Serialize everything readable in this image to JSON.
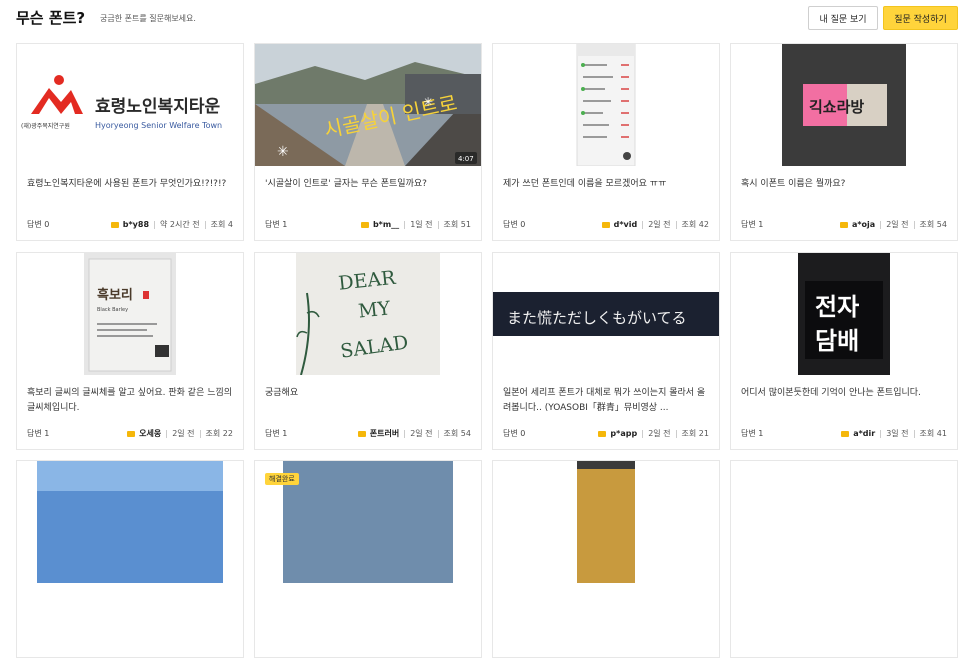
{
  "header": {
    "title": "무슨 폰트?",
    "subtitle": "궁금한 폰트를 질문해보세요.",
    "my_questions_label": "내 질문 보기",
    "write_question_label": "질문 작성하기"
  },
  "cards": [
    {
      "title": "효령노인복지타운에 사용된 폰트가 무엇인가요!?!?!?",
      "answers": "답변 0",
      "author": "b*y88",
      "time": "약 2시간 전",
      "views": "조회 4",
      "thumb_logo_main": "효령노인복지타운",
      "thumb_logo_sub": "(재)광주복지연구원",
      "thumb_logo_eng": "Hyoryeong Senior Welfare Town"
    },
    {
      "title": "'시골살이 인트로' 글자는 무슨 폰트일까요?",
      "answers": "답변 1",
      "author": "b*m__",
      "time": "1일 전",
      "views": "조회 51",
      "thumb_text": "시골살이 인트로",
      "video_duration": "4:07"
    },
    {
      "title": "제가 쓰던 폰트인데 이름을 모르겠어요 ㅠㅠ",
      "answers": "답변 0",
      "author": "d*vid",
      "time": "2일 전",
      "views": "조회 42"
    },
    {
      "title": "혹시 이폰트 이름은 뭘까요?",
      "answers": "답변 1",
      "author": "a*oja",
      "time": "2일 전",
      "views": "조회 54",
      "thumb_text": "긱쇼라방"
    },
    {
      "title": "흑보리 글씨의 글씨체를 알고 싶어요. 판화 같은 느낌의 글씨체입니다.",
      "answers": "답변 1",
      "author": "오세웅",
      "time": "2일 전",
      "views": "조회 22",
      "thumb_text": "흑보리",
      "thumb_sub": "Black Barley"
    },
    {
      "title": "궁금해요",
      "answers": "답변 1",
      "author": "폰트러버",
      "time": "2일 전",
      "views": "조회 54",
      "thumb_text_1": "DEAR",
      "thumb_text_2": "MY",
      "thumb_text_3": "SALAD"
    },
    {
      "title": "일본어 세리프 폰트가 대체로 뭐가 쓰이는지 몰라서 올려봅니다.. (YOASOBI「群青」뮤비영상 ...",
      "answers": "답변 0",
      "author": "p*app",
      "time": "2일 전",
      "views": "조회 21",
      "thumb_text": "また慌ただしくもがいてる"
    },
    {
      "title": "어디서 많이본듯한데 기억이 안나는 폰트입니다.",
      "answers": "답변 1",
      "author": "a*dir",
      "time": "3일 전",
      "views": "조회 41",
      "thumb_text_1": "전자",
      "thumb_text_2": "담배"
    }
  ],
  "bottom_row": {
    "resolved_badge": "해결완료"
  },
  "colors": {
    "accent_yellow": "#ffd43b",
    "folder_icon": "#f5b70a",
    "border": "#e7e7e7"
  }
}
